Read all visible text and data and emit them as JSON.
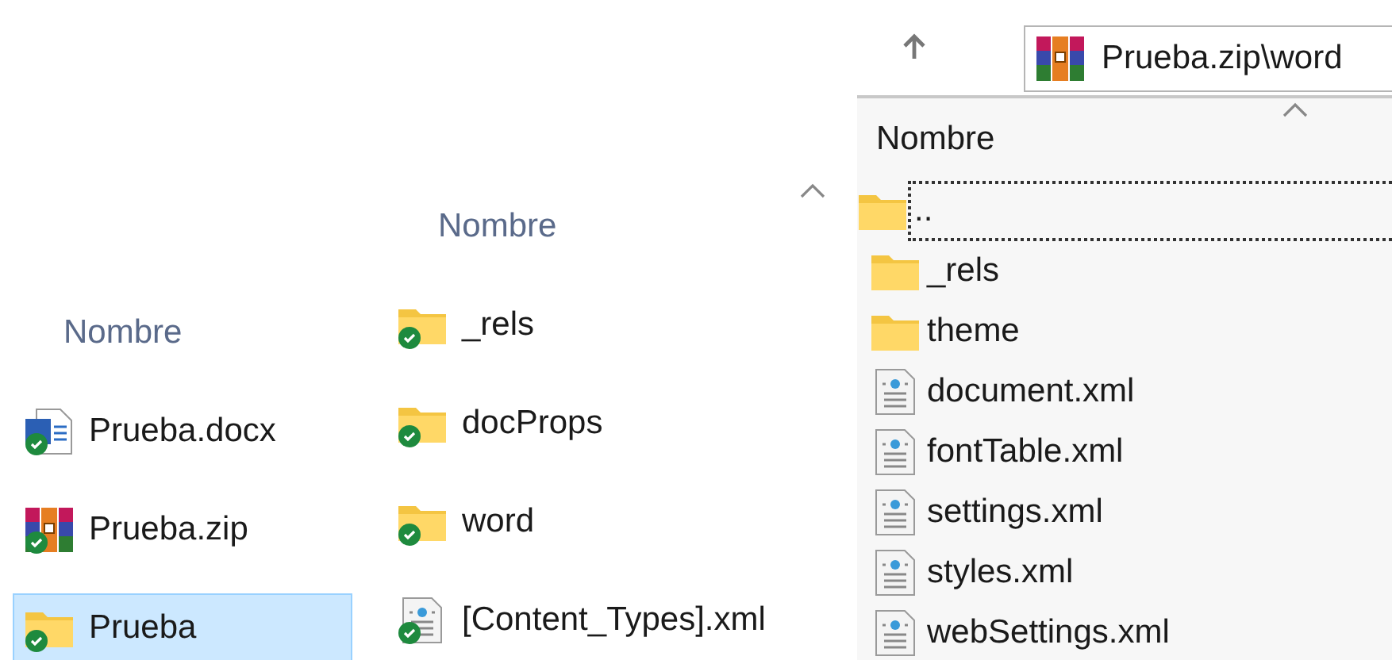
{
  "panels": [
    {
      "header": "Nombre",
      "sorted": false,
      "items": [
        {
          "kind": "word",
          "name": "Prueba.docx",
          "synced": true,
          "selected": false,
          "focused": false
        },
        {
          "kind": "archive",
          "name": "Prueba.zip",
          "synced": true,
          "selected": false,
          "focused": false
        },
        {
          "kind": "folder",
          "name": "Prueba",
          "synced": true,
          "selected": true,
          "focused": false
        }
      ]
    },
    {
      "header": "Nombre",
      "sorted": true,
      "items": [
        {
          "kind": "folder",
          "name": "_rels",
          "synced": true,
          "selected": false,
          "focused": false
        },
        {
          "kind": "folder",
          "name": "docProps",
          "synced": true,
          "selected": false,
          "focused": false
        },
        {
          "kind": "folder",
          "name": "word",
          "synced": true,
          "selected": false,
          "focused": false
        },
        {
          "kind": "xml",
          "name": "[Content_Types].xml",
          "synced": true,
          "selected": false,
          "focused": false
        }
      ]
    },
    {
      "toolbar": {
        "address": "Prueba.zip\\word"
      },
      "header": "Nombre",
      "sorted": true,
      "items": [
        {
          "kind": "folder",
          "name": "..",
          "synced": false,
          "selected": false,
          "focused": true
        },
        {
          "kind": "folder",
          "name": "_rels",
          "synced": false,
          "selected": false,
          "focused": false
        },
        {
          "kind": "folder",
          "name": "theme",
          "synced": false,
          "selected": false,
          "focused": false
        },
        {
          "kind": "xml",
          "name": "document.xml",
          "synced": false,
          "selected": false,
          "focused": false
        },
        {
          "kind": "xml",
          "name": "fontTable.xml",
          "synced": false,
          "selected": false,
          "focused": false
        },
        {
          "kind": "xml",
          "name": "settings.xml",
          "synced": false,
          "selected": false,
          "focused": false
        },
        {
          "kind": "xml",
          "name": "styles.xml",
          "synced": false,
          "selected": false,
          "focused": false
        },
        {
          "kind": "xml",
          "name": "webSettings.xml",
          "synced": false,
          "selected": false,
          "focused": false
        }
      ]
    }
  ]
}
